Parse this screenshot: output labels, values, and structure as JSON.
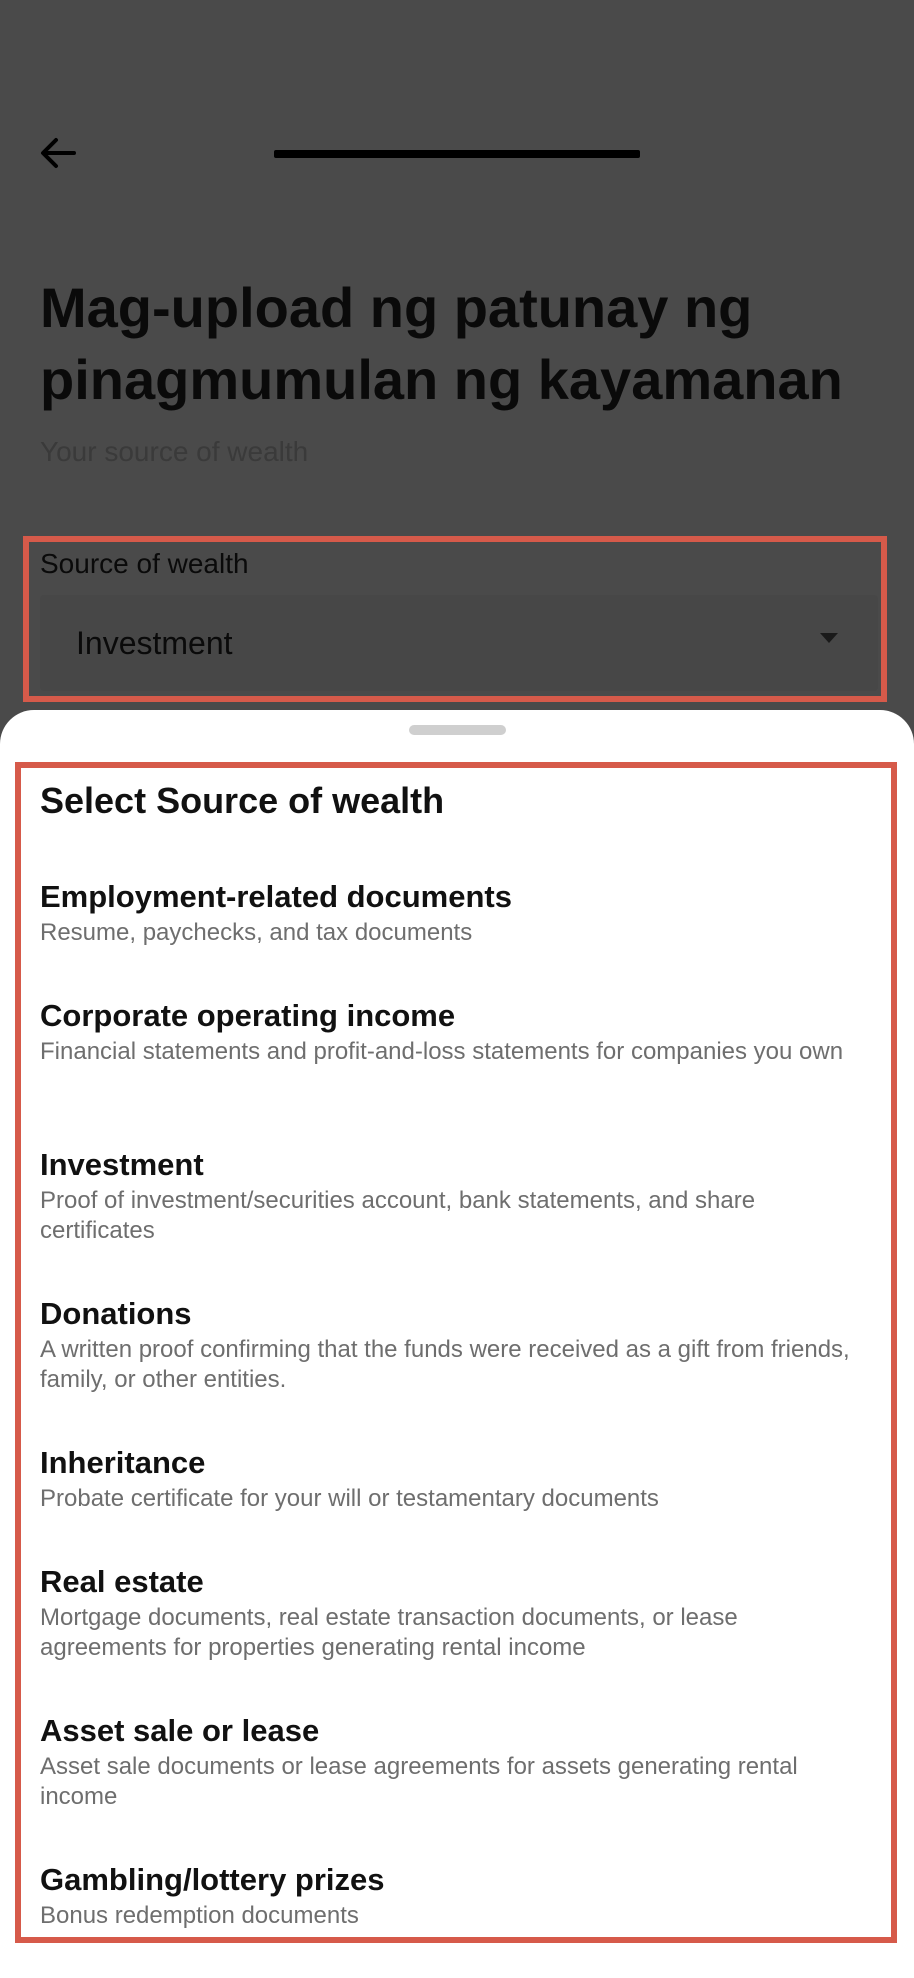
{
  "header": {
    "back_icon": "arrow-left-icon",
    "progress_fraction": 1.0
  },
  "page": {
    "title": "Mag-upload ng patunay ng pinagmumulan ng kayamanan",
    "subtitle": "Your source of wealth"
  },
  "field": {
    "label": "Source of wealth",
    "value": "Investment",
    "caret_icon": "caret-down-icon"
  },
  "sheet": {
    "title": "Select Source of wealth",
    "options": [
      {
        "title": "Employment-related documents",
        "desc": "Resume, paychecks, and tax documents"
      },
      {
        "title": "Corporate operating income",
        "desc": "Financial statements and profit-and-loss statements for companies you own"
      },
      {
        "title": "Investment",
        "desc": "Proof of investment/securities account, bank statements, and share certificates"
      },
      {
        "title": "Donations",
        "desc": "A written proof confirming that the funds were received as a gift from friends, family, or other entities."
      },
      {
        "title": "Inheritance",
        "desc": "Probate certificate for your will or testamentary documents"
      },
      {
        "title": "Real estate",
        "desc": "Mortgage documents, real estate transaction documents, or lease agreements for properties generating rental income"
      },
      {
        "title": "Asset sale or lease",
        "desc": "Asset sale documents or lease agreements for assets generating rental income"
      },
      {
        "title": "Gambling/lottery prizes",
        "desc": "Bonus redemption documents"
      }
    ]
  },
  "colors": {
    "overlay": "#4a4a4a",
    "highlight": "#d65a4a",
    "sheet_bg": "#ffffff"
  }
}
